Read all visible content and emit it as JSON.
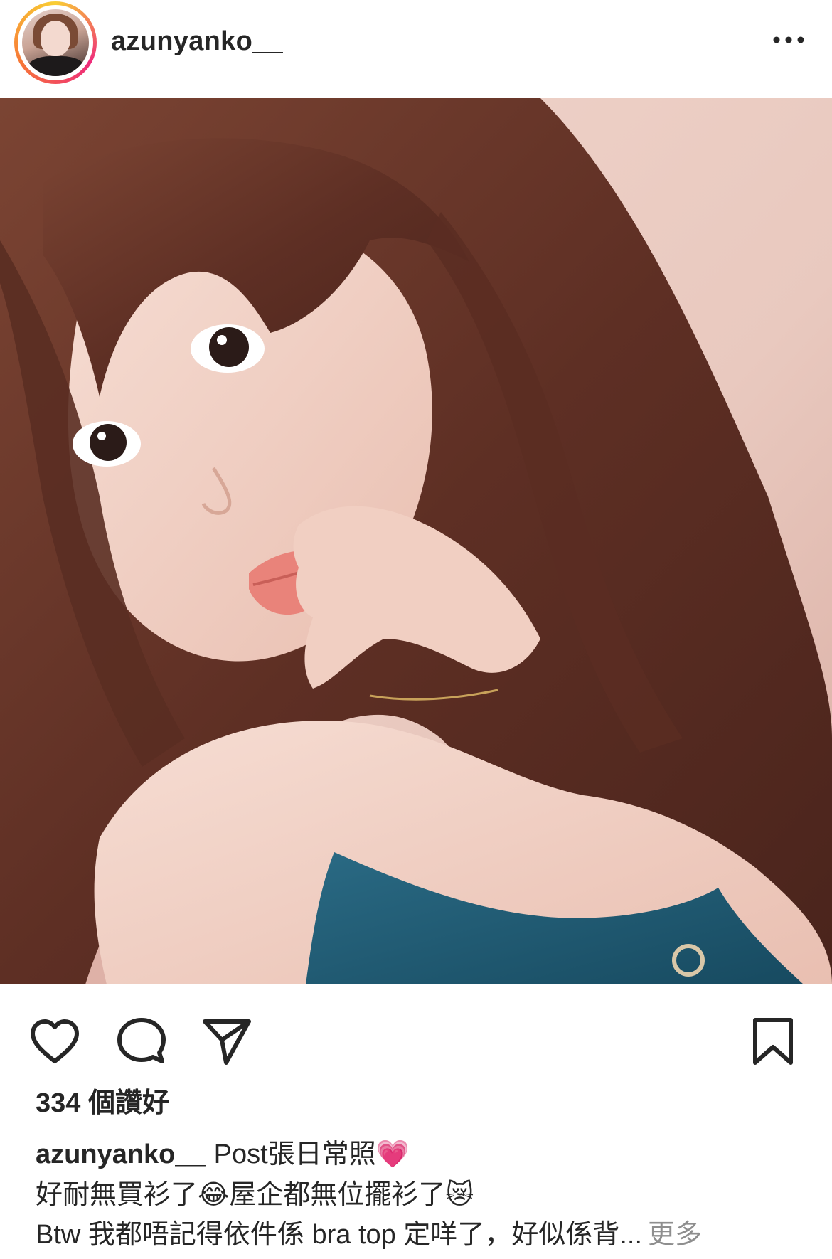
{
  "header": {
    "username": "azunyanko__",
    "avatar_label": "profile-photo",
    "more_icon": "more-horizontal-icon"
  },
  "post": {
    "image_label": "selfie-photo",
    "colors": {
      "background": "#e8c6bd",
      "hair": "#6b3a2c",
      "skin": "#f2d2c6",
      "top": "#1f5a73"
    }
  },
  "actions": {
    "like_icon": "heart-icon",
    "comment_icon": "comment-icon",
    "share_icon": "send-icon",
    "save_icon": "bookmark-icon"
  },
  "likes": {
    "text": "334 個讚好"
  },
  "caption": {
    "username": "azunyanko__",
    "line1_text": "Post張日常照",
    "line1_emoji": "💗",
    "line2_part1": "好耐無買衫了",
    "line2_emoji1": "😂",
    "line2_part2": "屋企都無位擺衫了",
    "line2_emoji2": "😿",
    "line3_text": "Btw 我都唔記得依件係 bra top 定咩了，好似係背...",
    "more_label": "更多"
  }
}
